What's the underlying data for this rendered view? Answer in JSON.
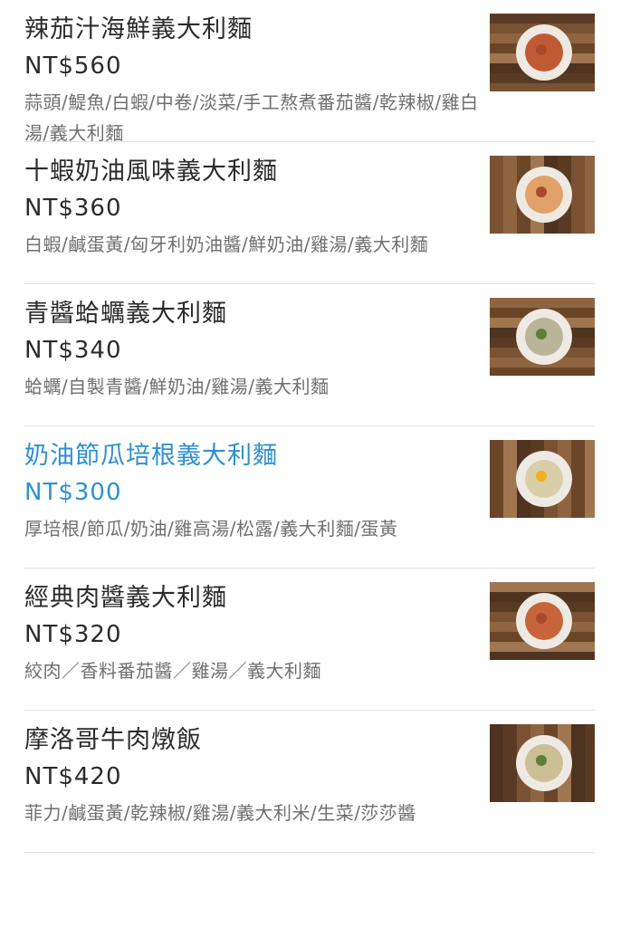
{
  "menu": {
    "items": [
      {
        "name": "辣茄汁海鮮義大利麵",
        "price": "NT$560",
        "description": "蒜頭/鯷魚/白蝦/中卷/淡菜/手工熬煮番茄醬/乾辣椒/雞白湯/義大利麵",
        "image": "seafood-tomato-pasta-photo",
        "plate_color": "#c05a35",
        "highlighted": false
      },
      {
        "name": "十蝦奶油風味義大利麵",
        "price": "NT$360",
        "description": "白蝦/鹹蛋黃/匈牙利奶油醬/鮮奶油/雞湯/義大利麵",
        "image": "shrimp-cream-pasta-photo",
        "plate_color": "#e2a168",
        "highlighted": false
      },
      {
        "name": "青醬蛤蠣義大利麵",
        "price": "NT$340",
        "description": "蛤蠣/自製青醬/鮮奶油/雞湯/義大利麵",
        "image": "clam-pesto-pasta-photo",
        "plate_color": "#b9b49a",
        "highlighted": false
      },
      {
        "name": "奶油節瓜培根義大利麵",
        "price": "NT$300",
        "description": "厚培根/節瓜/奶油/雞高湯/松露/義大利麵/蛋黃",
        "image": "zucchini-bacon-pasta-photo",
        "plate_color": "#d8cfa8",
        "highlighted": true
      },
      {
        "name": "經典肉醬義大利麵",
        "price": "NT$320",
        "description": "絞肉／香料番茄醬／雞湯／義大利麵",
        "image": "bolognese-pasta-photo",
        "plate_color": "#c8643a",
        "highlighted": false
      },
      {
        "name": "摩洛哥牛肉燉飯",
        "price": "NT$420",
        "description": "菲力/鹹蛋黃/乾辣椒/雞湯/義大利米/生菜/莎莎醬",
        "image": "moroccan-beef-risotto-photo",
        "plate_color": "#cdbf95",
        "highlighted": false
      }
    ]
  }
}
